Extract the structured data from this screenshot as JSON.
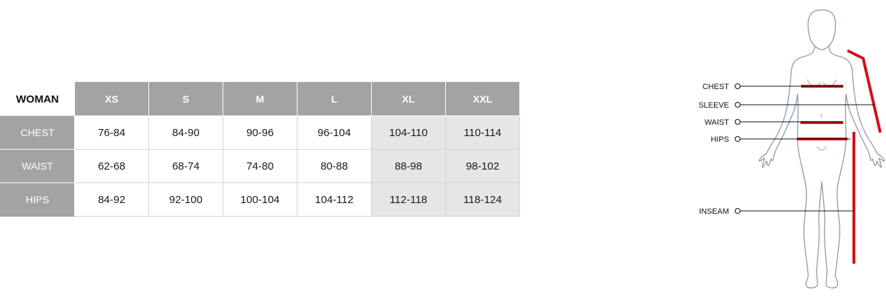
{
  "table": {
    "corner": "WOMAN",
    "sizes": [
      "XS",
      "S",
      "M",
      "L",
      "XL",
      "XXL"
    ],
    "rows": [
      {
        "label": "CHEST",
        "values": [
          "76-84",
          "84-90",
          "90-96",
          "96-104",
          "104-110",
          "110-114"
        ]
      },
      {
        "label": "WAIST",
        "values": [
          "62-68",
          "68-74",
          "74-80",
          "80-88",
          "88-98",
          "98-102"
        ]
      },
      {
        "label": "HIPS",
        "values": [
          "84-92",
          "92-100",
          "100-104",
          "104-112",
          "112-118",
          "118-124"
        ]
      }
    ],
    "colors": {
      "header": "#a3a3a3",
      "shaded": "#e6e6e6",
      "border": "#d4d4d4"
    }
  },
  "diagram": {
    "labels": {
      "chest": "CHEST",
      "sleeve": "SLEEVE",
      "waist": "WAIST",
      "hips": "HIPS",
      "inseam": "INSEAM"
    },
    "colors": {
      "measure": "#d0111b",
      "outline": "#8a9aa8"
    }
  }
}
